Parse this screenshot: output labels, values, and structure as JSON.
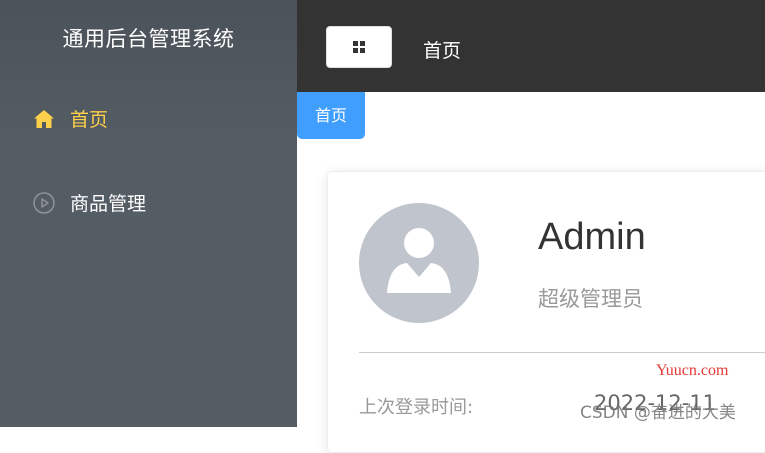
{
  "sidebar": {
    "title": "通用后台管理系统",
    "items": [
      {
        "label": "首页",
        "icon": "home-icon",
        "active": true
      },
      {
        "label": "商品管理",
        "icon": "video-play-icon",
        "active": false
      }
    ],
    "active_color": "#ffd04b",
    "background": "#545c64"
  },
  "header": {
    "breadcrumb": "首页",
    "toggle_icon": "menu-grid-icon",
    "background": "#333333"
  },
  "tabs": [
    {
      "label": "首页",
      "active": true,
      "color": "#409eff"
    }
  ],
  "user_card": {
    "name": "Admin",
    "role": "超级管理员",
    "avatar_icon": "user-avatar-icon",
    "last_login_label": "上次登录时间:",
    "last_login_value": "2022-12-11"
  },
  "watermarks": {
    "site": "Yuucn.com",
    "csdn": "CSDN @奋进的大美"
  }
}
